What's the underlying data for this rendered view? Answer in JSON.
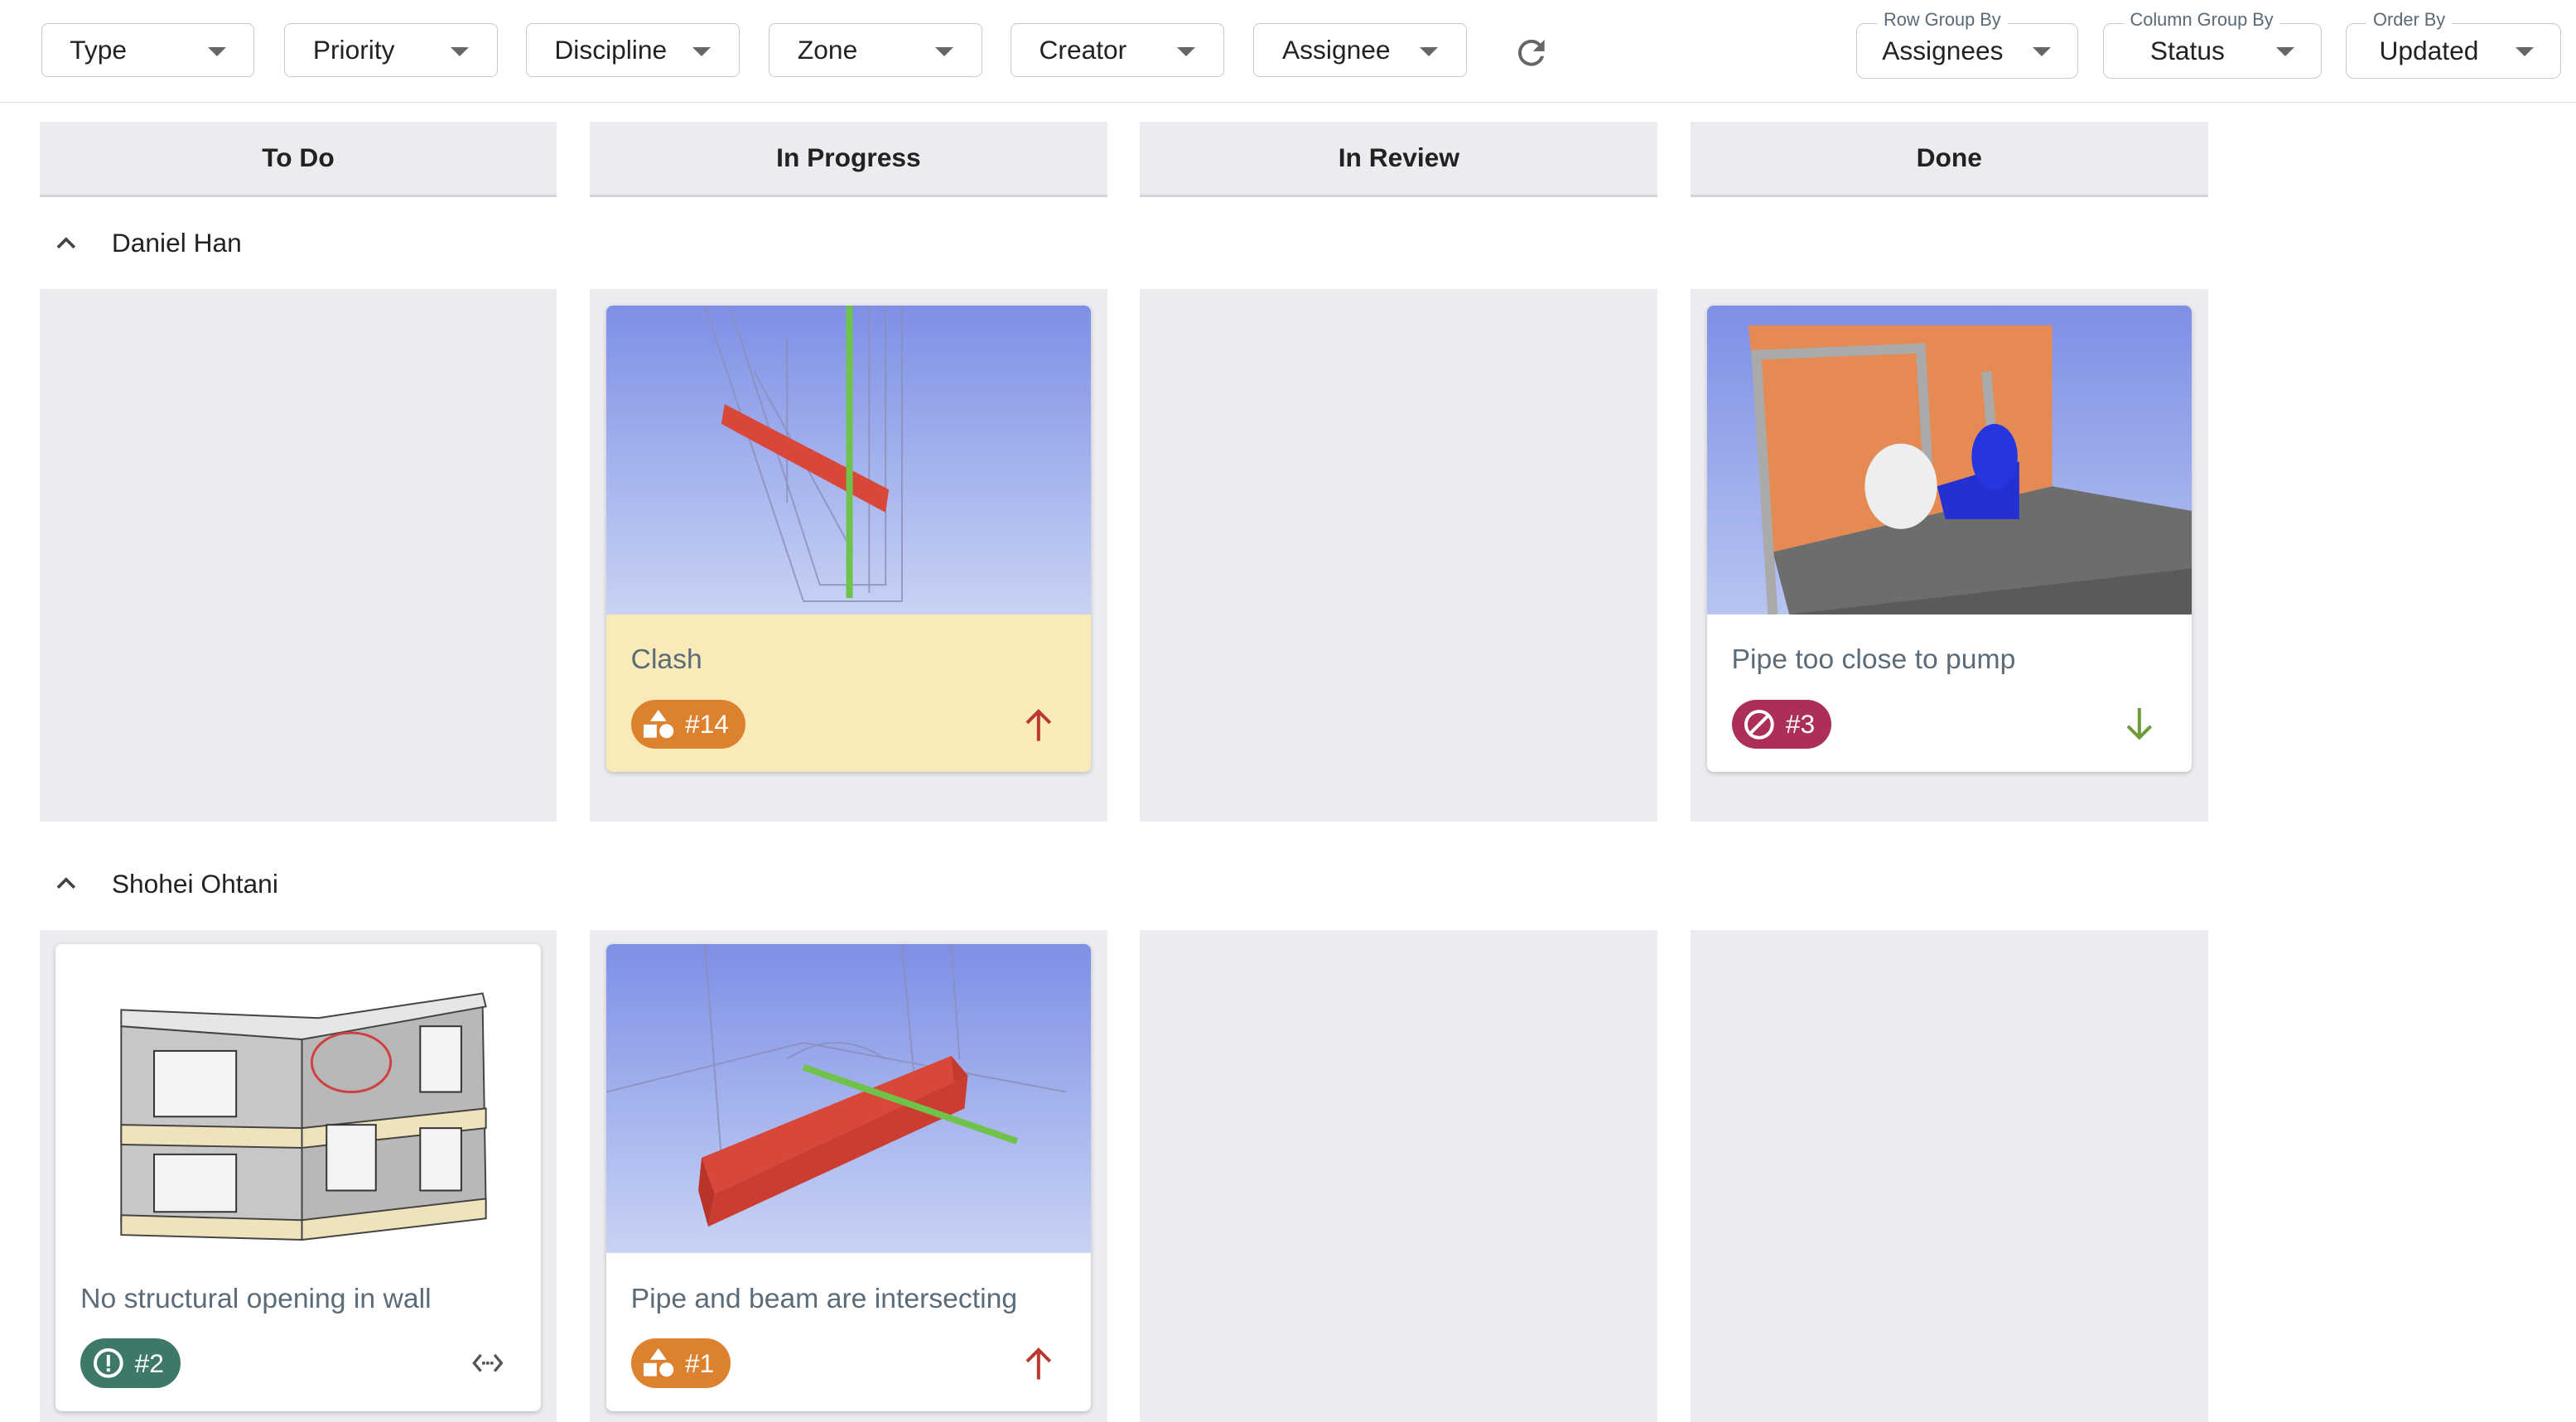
{
  "toolbar": {
    "filters": [
      "Type",
      "Priority",
      "Discipline",
      "Zone",
      "Creator",
      "Assignee"
    ],
    "refresh_icon": "refresh-icon",
    "row_group": {
      "label": "Row Group By",
      "value": "Assignees"
    },
    "column_group": {
      "label": "Column Group By",
      "value": "Status"
    },
    "order_by": {
      "label": "Order By",
      "value": "Updated"
    }
  },
  "columns": [
    "To Do",
    "In Progress",
    "In Review",
    "Done"
  ],
  "groups": [
    {
      "name": "Daniel Han",
      "cards": [
        {
          "column": "In Progress",
          "title": "Clash",
          "number": "#14",
          "type_icon": "shapes-icon",
          "type_color": "#dc822f",
          "priority": "high",
          "highlighted": true
        },
        {
          "column": "Done",
          "title": "Pipe too close to pump",
          "number": "#3",
          "type_icon": "blocked-icon",
          "type_color": "#ab2f5a",
          "priority": "low"
        }
      ]
    },
    {
      "name": "Shohei Ohtani",
      "cards": [
        {
          "column": "To Do",
          "title": "No structural opening in wall",
          "number": "#2",
          "type_icon": "alert-icon",
          "type_color": "#3e7868",
          "priority": "medium"
        },
        {
          "column": "In Progress",
          "title": "Pipe and beam are intersecting",
          "number": "#1",
          "type_icon": "shapes-icon",
          "type_color": "#dc822f",
          "priority": "high"
        }
      ]
    }
  ],
  "colors": {
    "high": "#b9382f",
    "low": "#6f9a3c",
    "medium": "#555555",
    "lane": "#ebecf0",
    "highlight": "#f9eab9"
  }
}
